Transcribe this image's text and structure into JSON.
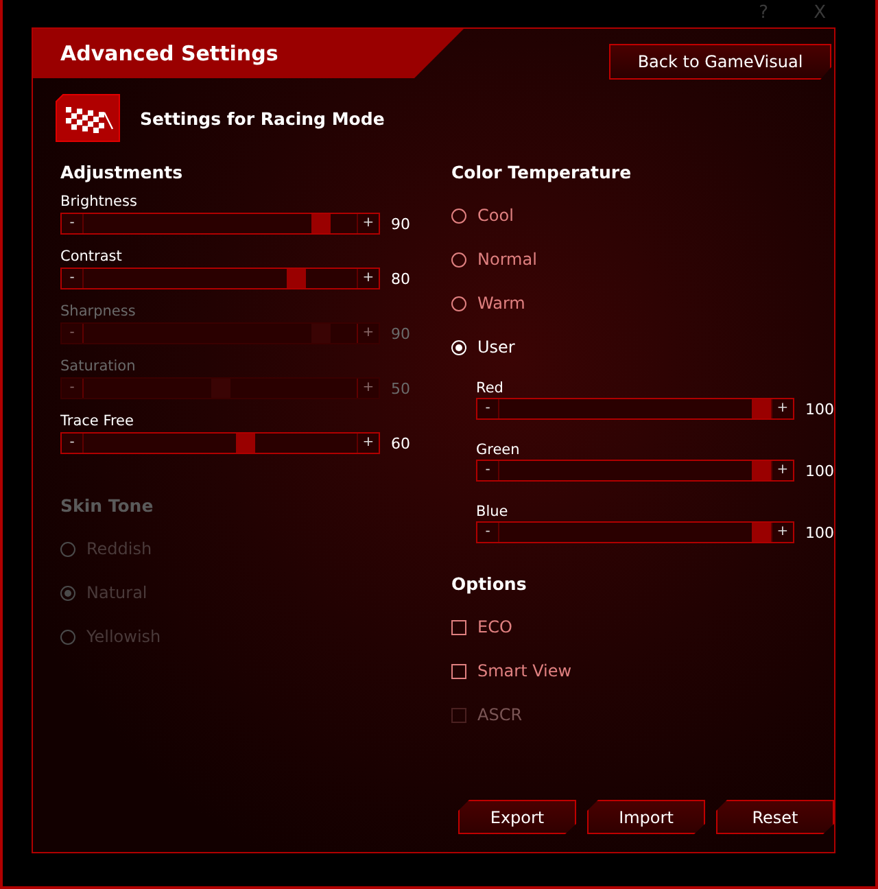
{
  "window": {
    "help": "?",
    "close": "X"
  },
  "header": {
    "title": "Advanced Settings",
    "back_button": "Back to GameVisual"
  },
  "mode": {
    "title": "Settings for Racing Mode"
  },
  "adjustments": {
    "title": "Adjustments",
    "sliders": [
      {
        "label": "Brightness",
        "level": 0.9,
        "reading": "90",
        "disabled": false,
        "minus": "-",
        "plus": "+"
      },
      {
        "label": "Contrast",
        "level": 0.8,
        "reading": "80",
        "disabled": false,
        "minus": "-",
        "plus": "+"
      },
      {
        "label": "Sharpness",
        "level": 0.9,
        "reading": "90",
        "disabled": true,
        "minus": "-",
        "plus": "+"
      },
      {
        "label": "Saturation",
        "level": 0.5,
        "reading": "50",
        "disabled": true,
        "minus": "-",
        "plus": "+"
      },
      {
        "label": "Trace Free",
        "level": 0.6,
        "reading": "60",
        "disabled": false,
        "minus": "-",
        "plus": "+"
      }
    ]
  },
  "skin_tone": {
    "title": "Skin Tone",
    "disabled": true,
    "options": [
      {
        "label": "Reddish",
        "selected": false
      },
      {
        "label": "Natural",
        "selected": true
      },
      {
        "label": "Yellowish",
        "selected": false
      }
    ]
  },
  "color_temperature": {
    "title": "Color Temperature",
    "options": [
      {
        "label": "Cool",
        "selected": false
      },
      {
        "label": "Normal",
        "selected": false
      },
      {
        "label": "Warm",
        "selected": false
      },
      {
        "label": "User",
        "selected": true
      }
    ],
    "sliders": [
      {
        "label": "Red",
        "level": 1,
        "reading": "100",
        "minus": "-",
        "plus": "+"
      },
      {
        "label": "Green",
        "level": 1,
        "reading": "100",
        "minus": "-",
        "plus": "+"
      },
      {
        "label": "Blue",
        "level": 1,
        "reading": "100",
        "minus": "-",
        "plus": "+"
      }
    ]
  },
  "options": {
    "title": "Options",
    "items": [
      {
        "label": "ECO",
        "checked": false,
        "disabled": false
      },
      {
        "label": "Smart View",
        "checked": false,
        "disabled": false
      },
      {
        "label": "ASCR",
        "checked": false,
        "disabled": true
      }
    ]
  },
  "buttons": [
    "Export",
    "Import",
    "Reset"
  ]
}
